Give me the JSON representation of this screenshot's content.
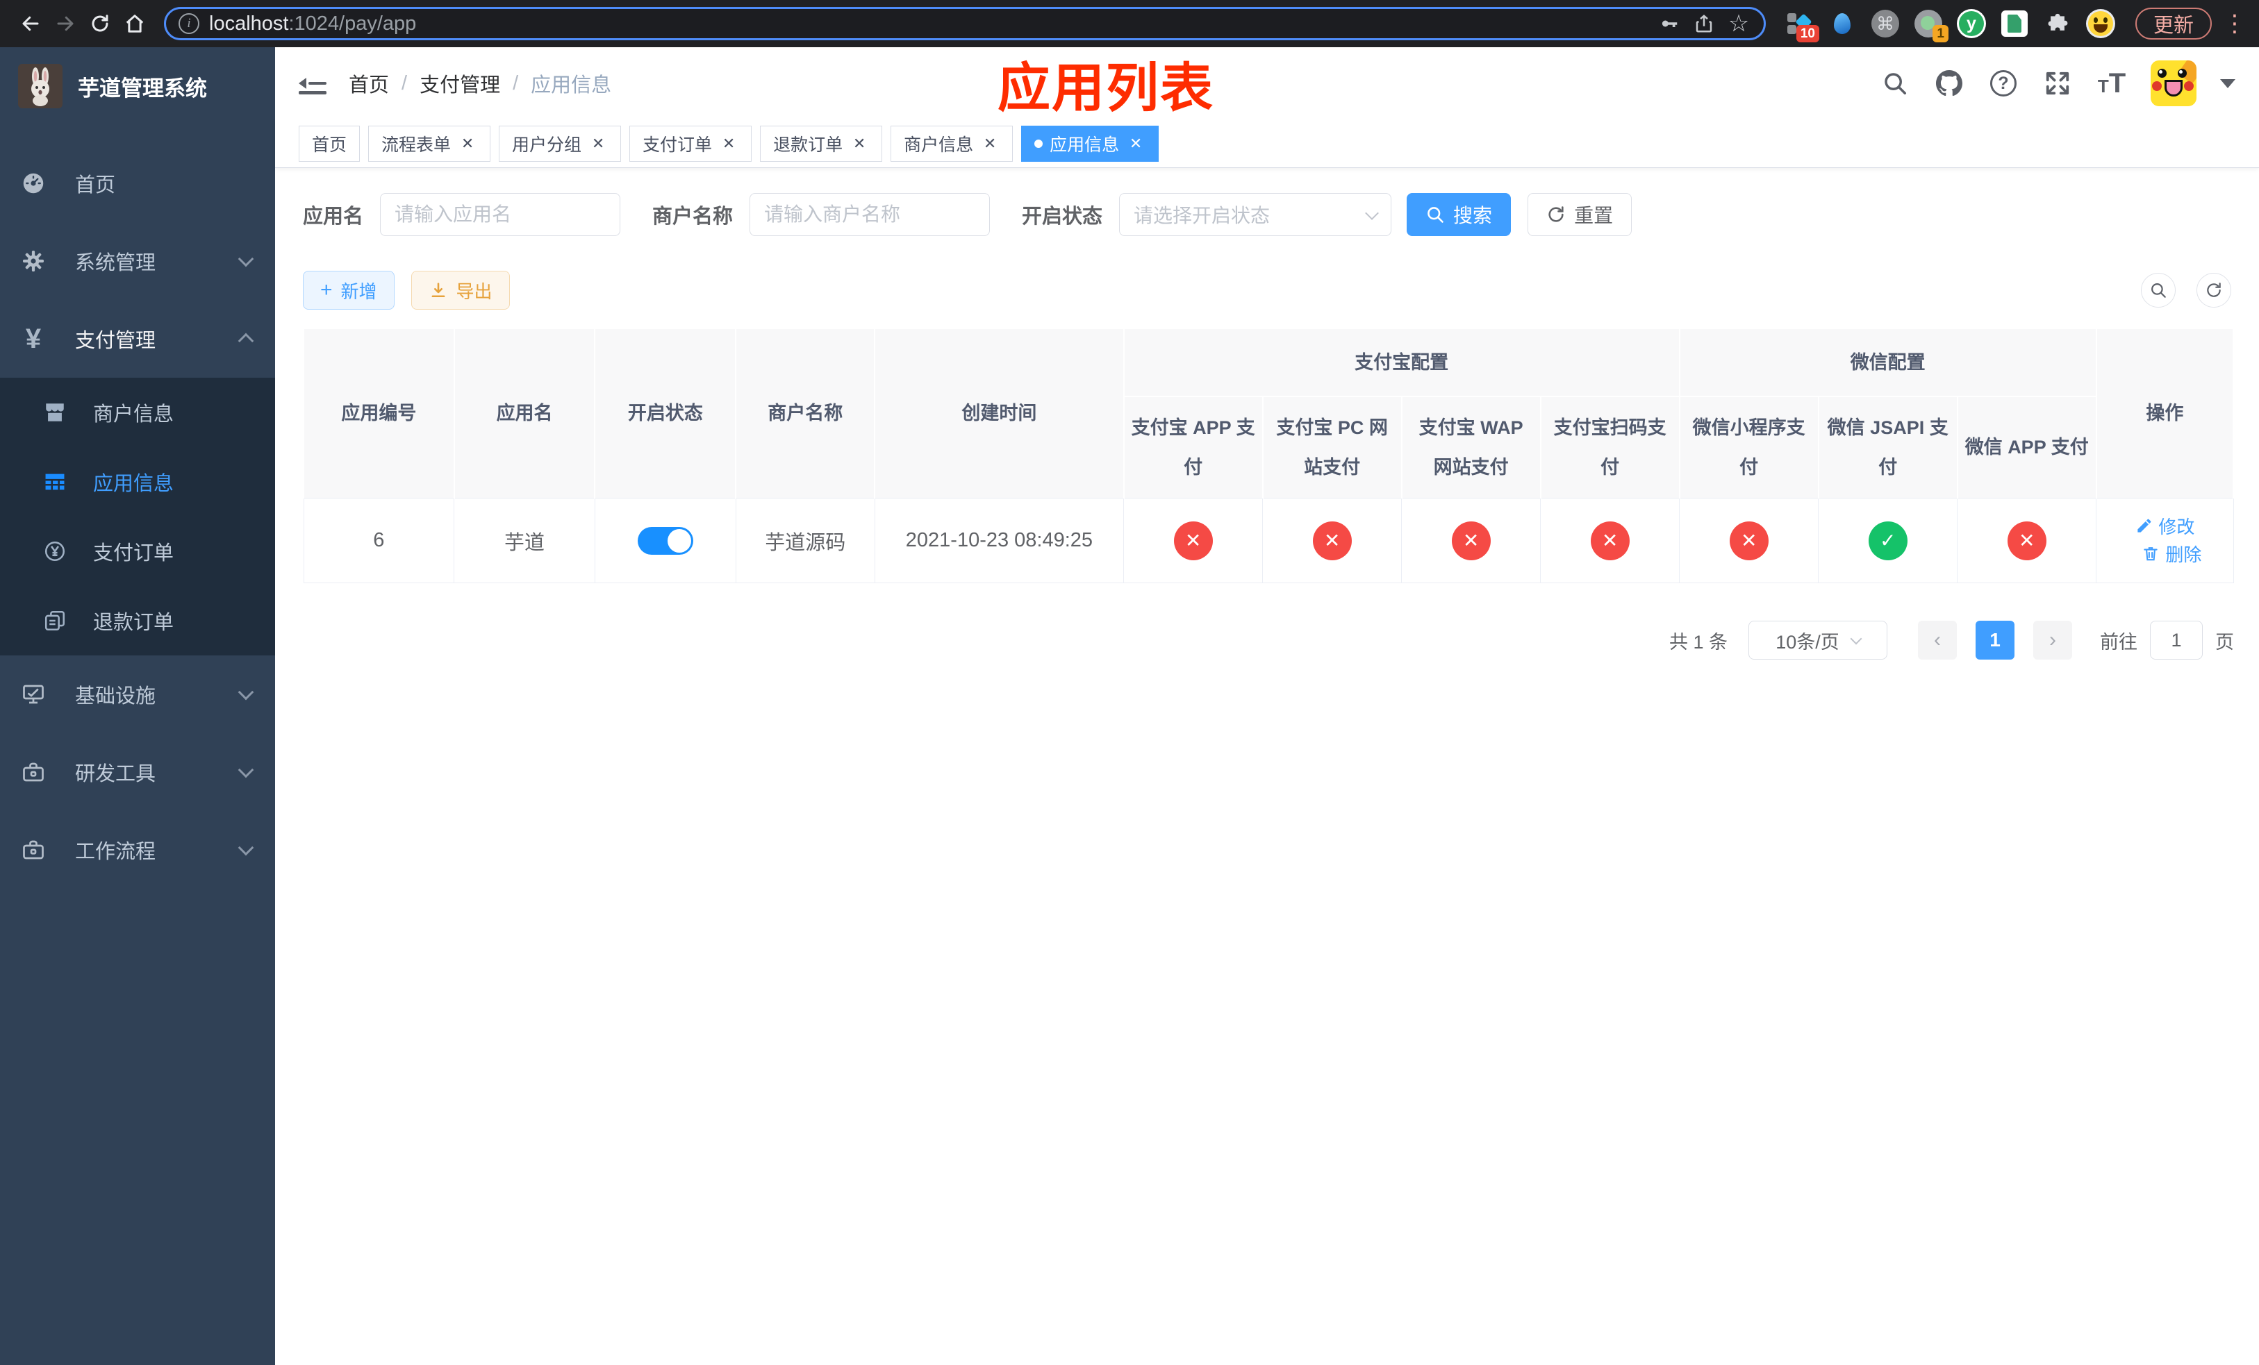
{
  "browser": {
    "url": {
      "host": "localhost",
      "path": ":1024/pay/app"
    },
    "update_label": "更新",
    "ext_badge_grid": "10",
    "ext_badge_cam": "1",
    "ext_y_label": "y"
  },
  "icons": {
    "info": "i",
    "star": "☆",
    "command": "⌘",
    "dots": "⋮",
    "question": "?",
    "tt_small": "T",
    "tt_big": "T",
    "yen": "¥",
    "plus": "+",
    "check": "✓",
    "close": "✕",
    "chevron_left": "‹",
    "chevron_right": "›"
  },
  "sidebar": {
    "title": "芋道管理系统",
    "home": "首页",
    "system": "系统管理",
    "pay": "支付管理",
    "merchant": "商户信息",
    "app_info": "应用信息",
    "pay_order": "支付订单",
    "refund_order": "退款订单",
    "infra": "基础设施",
    "dev_tools": "研发工具",
    "workflow": "工作流程"
  },
  "navbar": {
    "breadcrumb": {
      "home": "首页",
      "level1": "支付管理",
      "level2": "应用信息",
      "separator": "/"
    },
    "annotation": "应用列表"
  },
  "tabs": [
    {
      "label": "首页",
      "closable": false,
      "active": false
    },
    {
      "label": "流程表单",
      "closable": true,
      "active": false
    },
    {
      "label": "用户分组",
      "closable": true,
      "active": false
    },
    {
      "label": "支付订单",
      "closable": true,
      "active": false
    },
    {
      "label": "退款订单",
      "closable": true,
      "active": false
    },
    {
      "label": "商户信息",
      "closable": true,
      "active": false
    },
    {
      "label": "应用信息",
      "closable": true,
      "active": true
    }
  ],
  "search": {
    "app_name_label": "应用名",
    "app_name_placeholder": "请输入应用名",
    "merchant_label": "商户名称",
    "merchant_placeholder": "请输入商户名称",
    "status_label": "开启状态",
    "status_placeholder": "请选择开启状态",
    "search_label": "搜索",
    "reset_label": "重置"
  },
  "toolbar": {
    "add_label": "新增",
    "export_label": "导出"
  },
  "table": {
    "headers": {
      "app_id": "应用编号",
      "app_name": "应用名",
      "status": "开启状态",
      "merchant_name": "商户名称",
      "create_time": "创建时间",
      "alipay_group": "支付宝配置",
      "alipay_app": "支付宝 APP 支付",
      "alipay_pc": "支付宝 PC 网站支付",
      "alipay_wap": "支付宝 WAP 网站支付",
      "alipay_qr": "支付宝扫码支付",
      "wechat_group": "微信配置",
      "wx_lite": "微信小程序支付",
      "wx_jsapi": "微信 JSAPI 支付",
      "wx_app": "微信 APP 支付",
      "actions": "操作"
    },
    "row": {
      "app_id": "6",
      "app_name": "芋道",
      "status_on": true,
      "merchant_name": "芋道源码",
      "create_time": "2021-10-23 08:49:25",
      "channels": {
        "alipay_app": "closed",
        "alipay_pc": "closed",
        "alipay_wap": "closed",
        "alipay_qr": "closed",
        "wx_lite": "closed",
        "wx_jsapi": "open",
        "wx_app": "closed"
      },
      "edit_label": "修改",
      "delete_label": "删除"
    }
  },
  "pagination": {
    "total": "共 1 条",
    "page_size": "10条/页",
    "current_page": "1",
    "goto_label": "前往",
    "goto_value": "1",
    "page_suffix": "页"
  }
}
